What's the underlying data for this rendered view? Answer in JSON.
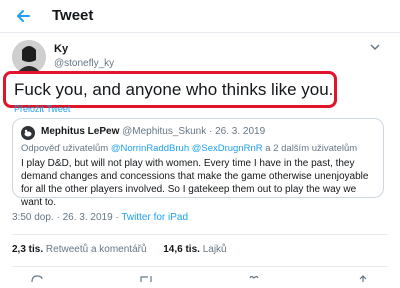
{
  "header": {
    "title": "Tweet",
    "back_icon": "arrow-left-icon"
  },
  "tweet": {
    "display_name": "Ky",
    "handle": "@stonefly_ky",
    "text": "Fuck you, and anyone who thinks like you.",
    "translate_label": "Přeložit Tweet",
    "highlight_color": "#e0142a"
  },
  "quote": {
    "name": "Mephitus LePew",
    "handle": "@Mephitus_Skunk",
    "date": "· 26. 3. 2019",
    "reply_prefix": "Odpověď uživatelům",
    "reply_mentions": "@NorrinRaddBruh @SexDrugnRnR",
    "reply_suffix": "a 2 dalším uživatelům",
    "body": "I play D&D, but will not play with women. Every time I have in the past, they demand changes and concessions that make the game otherwise unenjoyable for all the other players involved. So I gatekeep them out to play the way we want to."
  },
  "meta": {
    "time_date": "3:50 dop. · 26. 3. 2019 ·",
    "source": "Twitter for iPad"
  },
  "stats": {
    "retweets_count": "2,3 tis.",
    "retweets_label": "Retweetů a komentářů",
    "likes_count": "14,6 tis.",
    "likes_label": "Lajků"
  },
  "colors": {
    "accent": "#1da1f2",
    "muted": "#657786",
    "border": "#e6ecf0"
  }
}
